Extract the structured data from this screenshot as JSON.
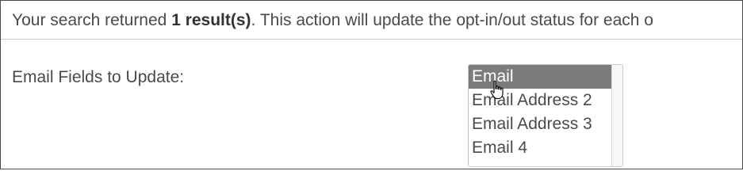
{
  "summary": {
    "prefix": "Your search returned ",
    "count": "1 result(s)",
    "suffix": ". This action will update the opt-in/out status for each o"
  },
  "email_fields": {
    "label": "Email Fields to Update:",
    "options": [
      {
        "label": "Email",
        "selected": true
      },
      {
        "label": "Email Address 2",
        "selected": false
      },
      {
        "label": "Email Address 3",
        "selected": false
      },
      {
        "label": "Email 4",
        "selected": false
      }
    ]
  },
  "cursor_icon": "hand-pointer-icon"
}
